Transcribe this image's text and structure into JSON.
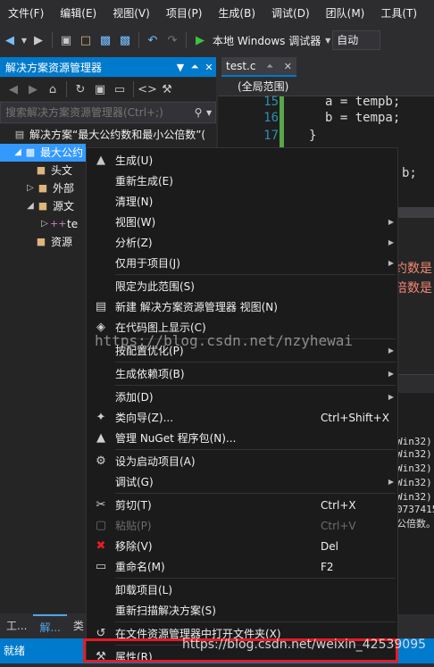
{
  "menubar": [
    "文件(F)",
    "编辑(E)",
    "视图(V)",
    "项目(P)",
    "生成(B)",
    "调试(D)",
    "团队(M)",
    "工具(T)"
  ],
  "toolbar": {
    "run_label": "本地 Windows 调试器",
    "config": "自动"
  },
  "solution_explorer": {
    "title": "解决方案资源管理器",
    "search_placeholder": "搜索解决方案资源管理器(Ctrl+;)",
    "tree": [
      {
        "label": "解决方案“最大公约数和最小公倍数”(",
        "indent": 0,
        "icon": "solution-icon"
      },
      {
        "label": "最大公约",
        "indent": 1,
        "icon": "project-icon",
        "selected": true
      },
      {
        "label": "头文",
        "indent": 2,
        "icon": "folder-icon"
      },
      {
        "label": "外部",
        "indent": 2,
        "icon": "folder-icon"
      },
      {
        "label": "源文",
        "indent": 2,
        "icon": "folder-icon"
      },
      {
        "label": "te",
        "indent": 3,
        "icon": "cpp-file-icon"
      },
      {
        "label": "资源",
        "indent": 2,
        "icon": "folder-icon"
      }
    ],
    "tabs": [
      "工...",
      "解...",
      "类"
    ]
  },
  "status": "就绪",
  "editor": {
    "tab": "test.c",
    "scope": "(全局范围)",
    "lines": [
      {
        "num": "15",
        "code": "a = tempb;"
      },
      {
        "num": "16",
        "code": "b = tempa;"
      },
      {
        "num": "17",
        "code": "}"
      }
    ],
    "partial_code": "b;",
    "errors": [
      "约数是",
      "倍数是"
    ],
    "output": [
      "Win32)",
      "Win32)",
      "Win32)",
      "Win32)",
      "Win32)",
      "0737415",
      "公倍数。"
    ]
  },
  "context_menu": {
    "items": [
      {
        "label": "生成(U)",
        "icon": "build-icon"
      },
      {
        "label": "重新生成(E)"
      },
      {
        "label": "清理(N)"
      },
      {
        "label": "视图(W)",
        "submenu": true
      },
      {
        "label": "分析(Z)",
        "submenu": true
      },
      {
        "label": "仅用于项目(J)",
        "submenu": true
      },
      {
        "sep": true
      },
      {
        "label": "限定为此范围(S)"
      },
      {
        "label": "新建 解决方案资源管理器 视图(N)",
        "icon": "new-view-icon"
      },
      {
        "label": "在代码图上显示(C)",
        "icon": "code-map-icon"
      },
      {
        "sep": true
      },
      {
        "label": "按配置优化(P)",
        "submenu": true
      },
      {
        "sep": true
      },
      {
        "label": "生成依赖项(B)",
        "submenu": true
      },
      {
        "sep": true
      },
      {
        "label": "添加(D)",
        "submenu": true
      },
      {
        "label": "类向导(Z)...",
        "shortcut": "Ctrl+Shift+X",
        "icon": "class-wizard-icon"
      },
      {
        "label": "管理 NuGet 程序包(N)...",
        "icon": "nuget-icon"
      },
      {
        "sep": true
      },
      {
        "label": "设为启动项目(A)",
        "icon": "gear-icon"
      },
      {
        "label": "调试(G)",
        "submenu": true
      },
      {
        "sep": true
      },
      {
        "label": "剪切(T)",
        "shortcut": "Ctrl+X",
        "icon": "scissors-icon"
      },
      {
        "label": "粘贴(P)",
        "shortcut": "Ctrl+V",
        "icon": "paste-icon",
        "disabled": true
      },
      {
        "label": "移除(V)",
        "shortcut": "Del",
        "icon": "remove-icon"
      },
      {
        "label": "重命名(M)",
        "shortcut": "F2",
        "icon": "rename-icon"
      },
      {
        "sep": true
      },
      {
        "label": "卸载项目(L)"
      },
      {
        "label": "重新扫描解决方案(S)"
      },
      {
        "sep": true
      },
      {
        "label": "在文件资源管理器中打开文件夹(X)",
        "icon": "open-folder-icon"
      },
      {
        "sep": true
      },
      {
        "label": "属性(R)",
        "icon": "wrench-icon"
      }
    ]
  },
  "watermarks": {
    "middle": "https://blog.csdn.net/nzyhewai",
    "bottom": "https://blog.csdn.net/weixin_42539095"
  },
  "colors": {
    "accent": "#007acc",
    "highlight": "#e51c23"
  }
}
